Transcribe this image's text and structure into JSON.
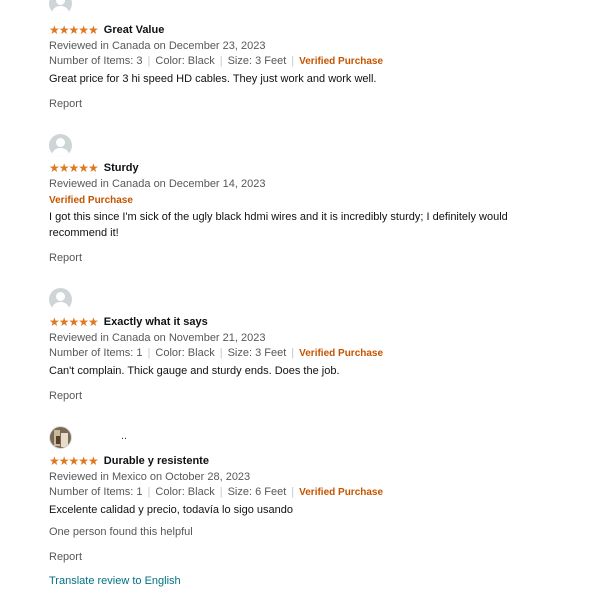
{
  "reviews": [
    {
      "username": "",
      "stars": 5,
      "stars_glyphs": "★★★★★",
      "title": "Great Value",
      "reviewed": "Reviewed in Canada on December 23, 2023",
      "number_of_items": "Number of Items: 3",
      "color": "Color: Black",
      "size": "Size: 3 Feet",
      "verified": "Verified Purchase",
      "body": "Great price for 3 hi speed HD cables. They just work and work well.",
      "report": "Report"
    },
    {
      "username": "",
      "stars": 5,
      "stars_glyphs": "★★★★★",
      "title": "Sturdy",
      "reviewed": "Reviewed in Canada on December 14, 2023",
      "verified": "Verified Purchase",
      "body": "I got this since I'm sick of the ugly black hdmi wires and it is incredibly sturdy; I definitely would recommend it!",
      "report": "Report"
    },
    {
      "username": "",
      "stars": 5,
      "stars_glyphs": "★★★★★",
      "title": "Exactly what it says",
      "reviewed": "Reviewed in Canada on November 21, 2023",
      "number_of_items": "Number of Items: 1",
      "color": "Color: Black",
      "size": "Size: 3 Feet",
      "verified": "Verified Purchase",
      "body": "Can't complain. Thick gauge and sturdy ends. Does the job.",
      "report": "Report"
    },
    {
      "username": "..",
      "stars": 5,
      "stars_glyphs": "★★★★★",
      "title": "Durable y resistente",
      "reviewed": "Reviewed in Mexico on October 28, 2023",
      "number_of_items": "Number of Items: 1",
      "color": "Color: Black",
      "size": "Size: 6 Feet",
      "verified": "Verified Purchase",
      "body": "Excelente calidad y precio, todavía lo sigo usando",
      "helpful": "One person found this helpful",
      "report": "Report",
      "translate": "Translate review to English"
    }
  ],
  "colors": {
    "star": "#de7921",
    "verified": "#c45500",
    "link": "#007185",
    "meta": "#565959"
  }
}
